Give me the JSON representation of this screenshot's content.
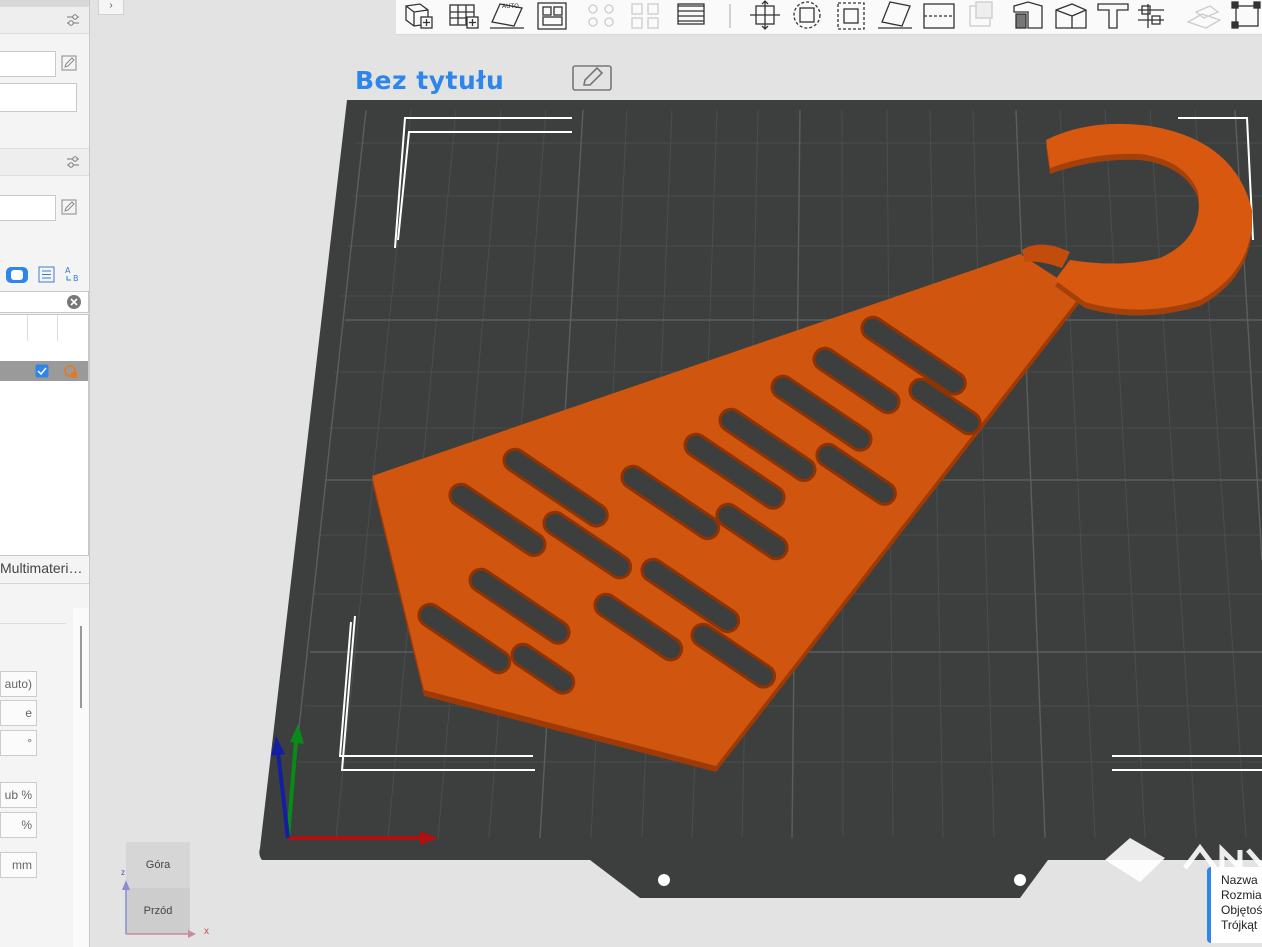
{
  "project": {
    "title": "Bez tytułu"
  },
  "left_panel": {
    "truncated_label": "Multimateri…",
    "fields": [
      {
        "label": "auto)"
      },
      {
        "label": "e (K…"
      },
      {
        "label": "°"
      },
      {
        "label": "ub %"
      },
      {
        "label": "%"
      },
      {
        "label": "mm"
      }
    ]
  },
  "toolbar": {
    "icons": [
      "add-object-icon",
      "grid-icon",
      "auto-orient-icon",
      "arrange-icon",
      "split-objects-icon",
      "split-parts-icon",
      "layers-icon",
      "move-icon",
      "rotate-icon",
      "scale-icon",
      "lay-on-face-icon",
      "cut-icon",
      "mesh-boolean-icon",
      "support-paint-icon",
      "seam-paint-icon",
      "color-paint-icon",
      "measure-icon",
      "assembly-icon",
      "text-icon",
      "cut-box-icon"
    ]
  },
  "view_cube": {
    "top_label": "Góra",
    "front_label": "Przód",
    "x_axis": "x",
    "z_axis": "z"
  },
  "info_panel": {
    "lines": [
      "Nazwa",
      "Rozmia",
      "Objętoś",
      "Trójkąt"
    ]
  },
  "colors": {
    "accent": "#2f86ea",
    "model": "#d0550f",
    "bed": "#3d3f3f",
    "grid": "#56595a"
  }
}
